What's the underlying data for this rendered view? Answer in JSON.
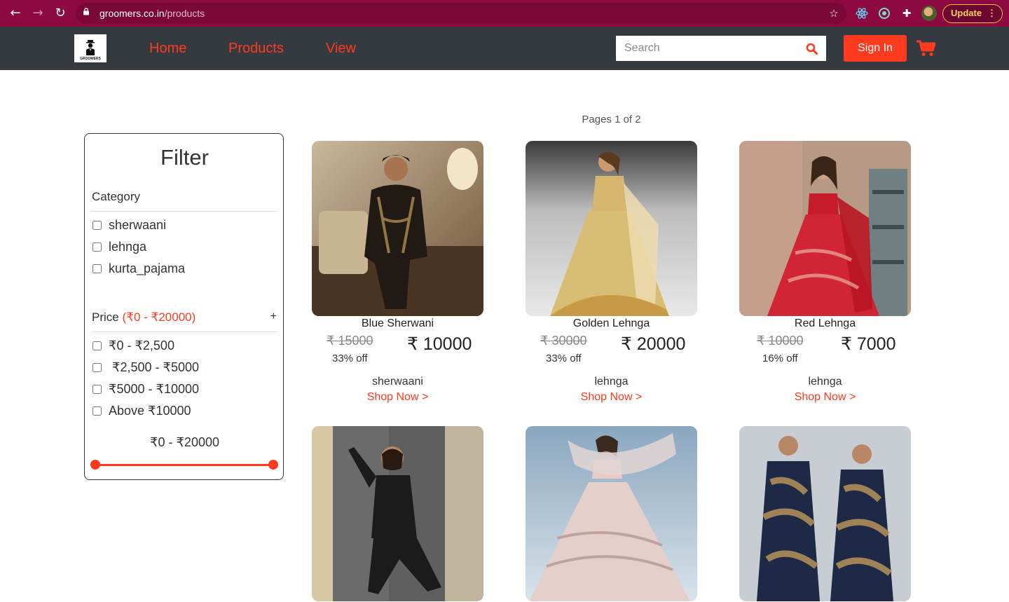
{
  "browser": {
    "url_host": "groomers.co.in",
    "url_path": "/products",
    "update_label": "Update"
  },
  "nav": {
    "logo_text": "GROOMERS",
    "links": [
      "Home",
      "Products",
      "View"
    ],
    "search_placeholder": "Search",
    "signin_label": "Sign In"
  },
  "pagination": {
    "text": "Pages 1 of 2"
  },
  "filter": {
    "title": "Filter",
    "category_heading": "Category",
    "categories": [
      "sherwaani",
      "lehnga",
      "kurta_pajama"
    ],
    "price_heading": "Price",
    "price_range": "(₹0 - ₹20000)",
    "price_toggle": "+",
    "price_options": [
      "₹0 - ₹2,500",
      "₹2,500 - ₹5000",
      "₹5000 - ₹10000",
      "Above ₹10000"
    ],
    "slider_label": "₹0 - ₹20000",
    "slider_min": 0,
    "slider_max": 20000
  },
  "products": [
    {
      "name": "Blue Sherwani",
      "old_price": "₹ 15000",
      "price": "₹ 10000",
      "discount": "33% off",
      "category": "sherwaani",
      "cta": "Shop Now >"
    },
    {
      "name": "Golden Lehnga",
      "old_price": "₹ 30000",
      "price": "₹ 20000",
      "discount": "33% off",
      "category": "lehnga",
      "cta": "Shop Now >"
    },
    {
      "name": "Red Lehnga",
      "old_price": "₹ 10000",
      "price": "₹ 7000",
      "discount": "16% off",
      "category": "lehnga",
      "cta": "Shop Now >"
    },
    {
      "name": "",
      "old_price": "",
      "price": "",
      "discount": "",
      "category": "",
      "cta": ""
    },
    {
      "name": "",
      "old_price": "",
      "price": "",
      "discount": "",
      "category": "",
      "cta": ""
    },
    {
      "name": "",
      "old_price": "",
      "price": "",
      "discount": "",
      "category": "",
      "cta": ""
    }
  ],
  "colors": {
    "brand_red": "#ff3b1f",
    "nav_bg": "#343a40",
    "browser_bg": "#8c0a3f"
  }
}
